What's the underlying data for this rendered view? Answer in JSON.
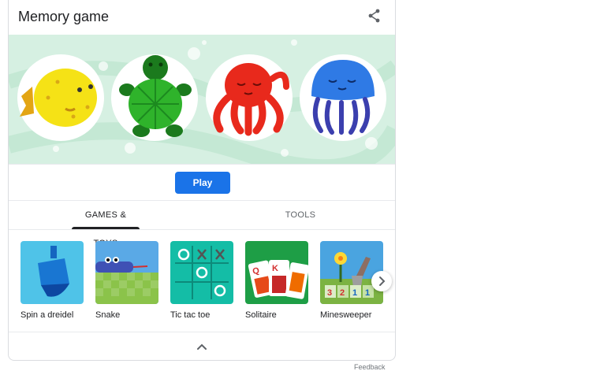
{
  "card": {
    "title": "Memory game"
  },
  "icons": {
    "share": "share-icon",
    "next": "chevron-right-icon",
    "collapse": "chevron-up-icon"
  },
  "hero": {
    "characters": [
      "pufferfish",
      "turtle",
      "octopus",
      "jellyfish"
    ],
    "colors": {
      "background": "#d6f0e2",
      "pufferfish": "#f5e216",
      "turtle": "#2fb32b",
      "octopus": "#e8291c",
      "jellyfish": "#2f7ae5"
    }
  },
  "play_button": {
    "label": "Play",
    "color": "#1a73e8"
  },
  "tabs": [
    {
      "label": "GAMES & TOYS",
      "selected": true
    },
    {
      "label": "TOOLS",
      "selected": false
    }
  ],
  "tiles": [
    {
      "label": "Spin a dreidel",
      "color": "#4fc3e8"
    },
    {
      "label": "Snake",
      "color": "#5aa9e6"
    },
    {
      "label": "Tic tac toe",
      "color": "#14bda6"
    },
    {
      "label": "Solitaire",
      "color": "#1e9e46"
    },
    {
      "label": "Minesweeper",
      "color": "#4aa4e0"
    }
  ],
  "footer": {
    "feedback": "Feedback"
  }
}
